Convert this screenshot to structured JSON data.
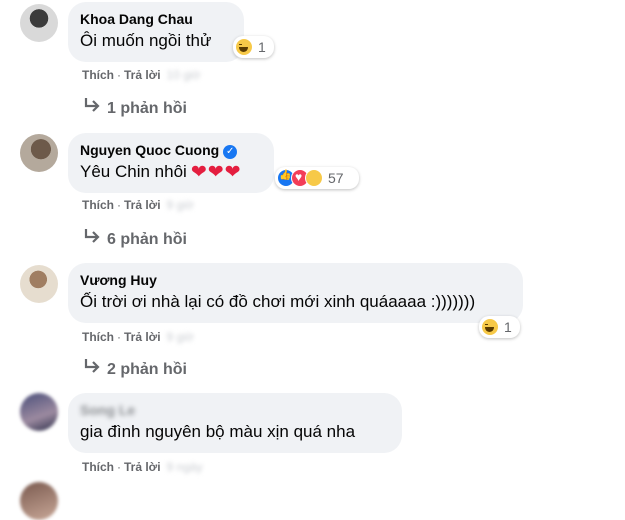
{
  "comments": [
    {
      "author": "Khoa Dang Chau",
      "text": "Ôi muốn ngồi thử",
      "reaction_count": "1",
      "actions": {
        "like": "Thích",
        "reply": "Trả lời",
        "time": "10 giờ"
      },
      "replies": "1 phản hồi"
    },
    {
      "author": "Nguyen Quoc Cuong",
      "verified": true,
      "text": "Yêu Chin nhôi",
      "hearts": "❤❤❤",
      "reaction_count": "57",
      "actions": {
        "like": "Thích",
        "reply": "Trả lời",
        "time": "9 giờ"
      },
      "replies": "6 phản hồi"
    },
    {
      "author": "Vương Huy",
      "text": "Ối trời ơi nhà lại có đồ chơi mới xinh quáaaaa :)))))))",
      "reaction_count": "1",
      "actions": {
        "like": "Thích",
        "reply": "Trả lời",
        "time": "9 giờ"
      },
      "replies": "2 phản hồi"
    },
    {
      "author": "Song Le",
      "text": "gia đình nguyên bộ màu xịn quá nha",
      "actions": {
        "like": "Thích",
        "reply": "Trả lời",
        "time": "9 ngày"
      }
    }
  ],
  "colors": {
    "bubble_bg": "#f0f2f5",
    "secondary_text": "#65676b",
    "verified_blue": "#1877f2",
    "heart_red": "#e41e3f"
  }
}
